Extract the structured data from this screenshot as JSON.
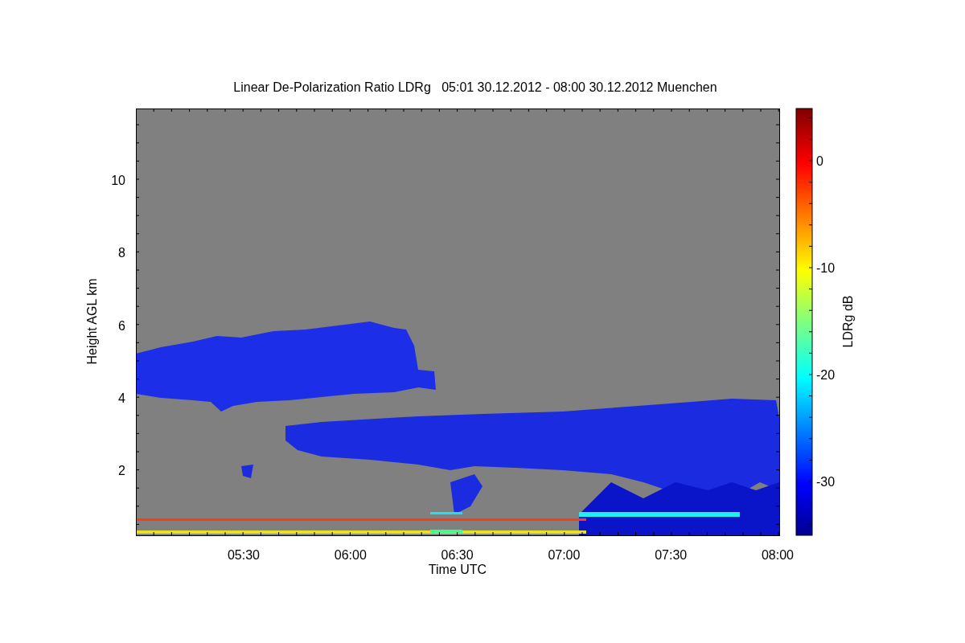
{
  "title": "Linear De-Polarization Ratio LDRg   05:01 30.12.2012 - 08:00 30.12.2012 Muenchen",
  "y_axis": {
    "label": "Height AGL km",
    "ticks": [
      "10",
      "8",
      "6",
      "4",
      "2"
    ]
  },
  "x_axis": {
    "label": "Time UTC",
    "ticks": [
      "05:30",
      "06:00",
      "06:30",
      "07:00",
      "07:30",
      "08:00"
    ]
  },
  "colorbar": {
    "label": "LDRg dB",
    "ticks": [
      "0",
      "-10",
      "-20",
      "-30"
    ]
  }
}
